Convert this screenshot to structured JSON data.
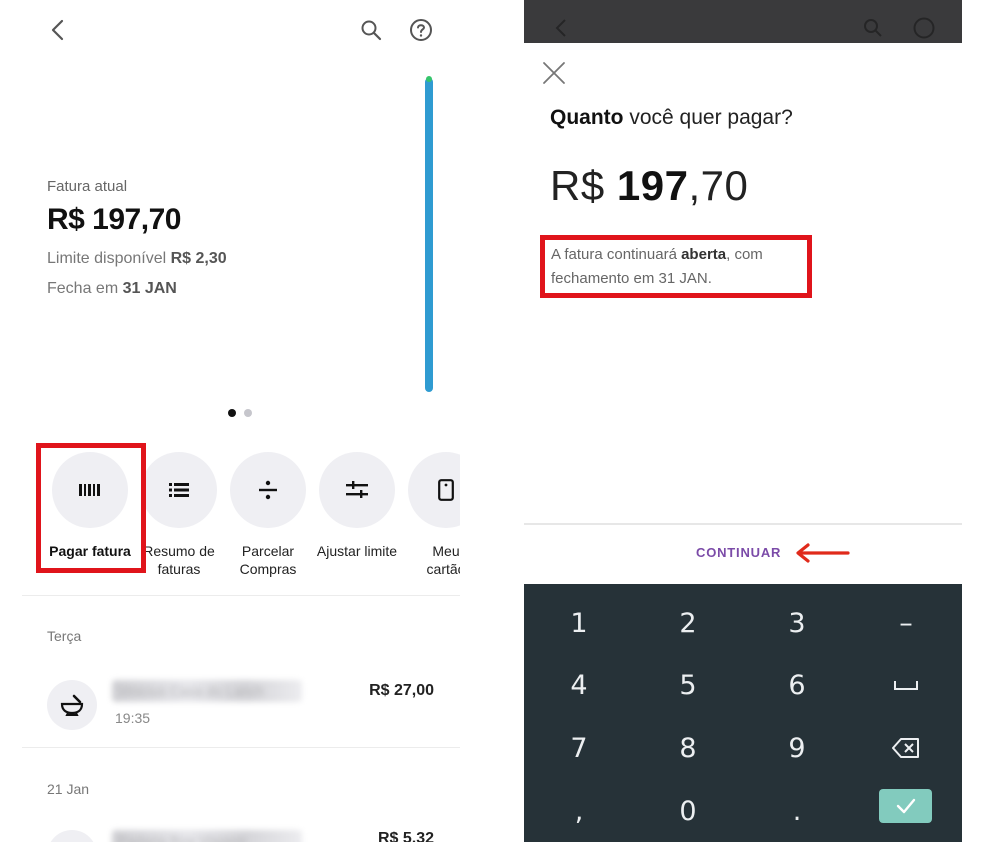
{
  "left": {
    "invoice_label": "Fatura atual",
    "invoice_amount": "R$ 197,70",
    "limit_prefix": "Limite disponível ",
    "limit_value": "R$ 2,30",
    "close_prefix": "Fecha em ",
    "close_value": "31 JAN",
    "actions": [
      {
        "label": "Pagar fatura",
        "icon": "barcode-icon"
      },
      {
        "label": "Resumo de faturas",
        "icon": "list-icon"
      },
      {
        "label": "Parcelar Compras",
        "icon": "divide-icon"
      },
      {
        "label": "Ajustar limite",
        "icon": "sliders-icon"
      },
      {
        "label": "Meu cartão",
        "icon": "card-icon"
      }
    ],
    "transactions": [
      {
        "day": "Terça",
        "name": "Vinicius Casa do Lanch",
        "time": "19:35",
        "amount": "R$ 27,00",
        "icon": "mortar-icon"
      },
      {
        "day": "21 Jan",
        "name": "Padaria Boa Viagem",
        "amount": "R$ 5,32"
      }
    ]
  },
  "right": {
    "question_strong": "Quanto",
    "question_rest": " você quer pagar?",
    "amount_prefix": "R$ ",
    "amount_int": "197",
    "amount_dec": ",70",
    "info_part1": "A fatura continuará ",
    "info_strong": "aberta",
    "info_part2": ", com fechamento em 31 JAN.",
    "continue_label": "CONTINUAR",
    "keys": [
      "1",
      "2",
      "3",
      "–",
      "4",
      "5",
      "6",
      "␣",
      "7",
      "8",
      "9",
      "⌫",
      ",",
      "0",
      ".",
      "✓"
    ],
    "colors": {
      "highlight": "#e0141b",
      "continue": "#7b4ba8",
      "keypad_bg": "#263238",
      "ok_key": "#82cbbe"
    }
  }
}
